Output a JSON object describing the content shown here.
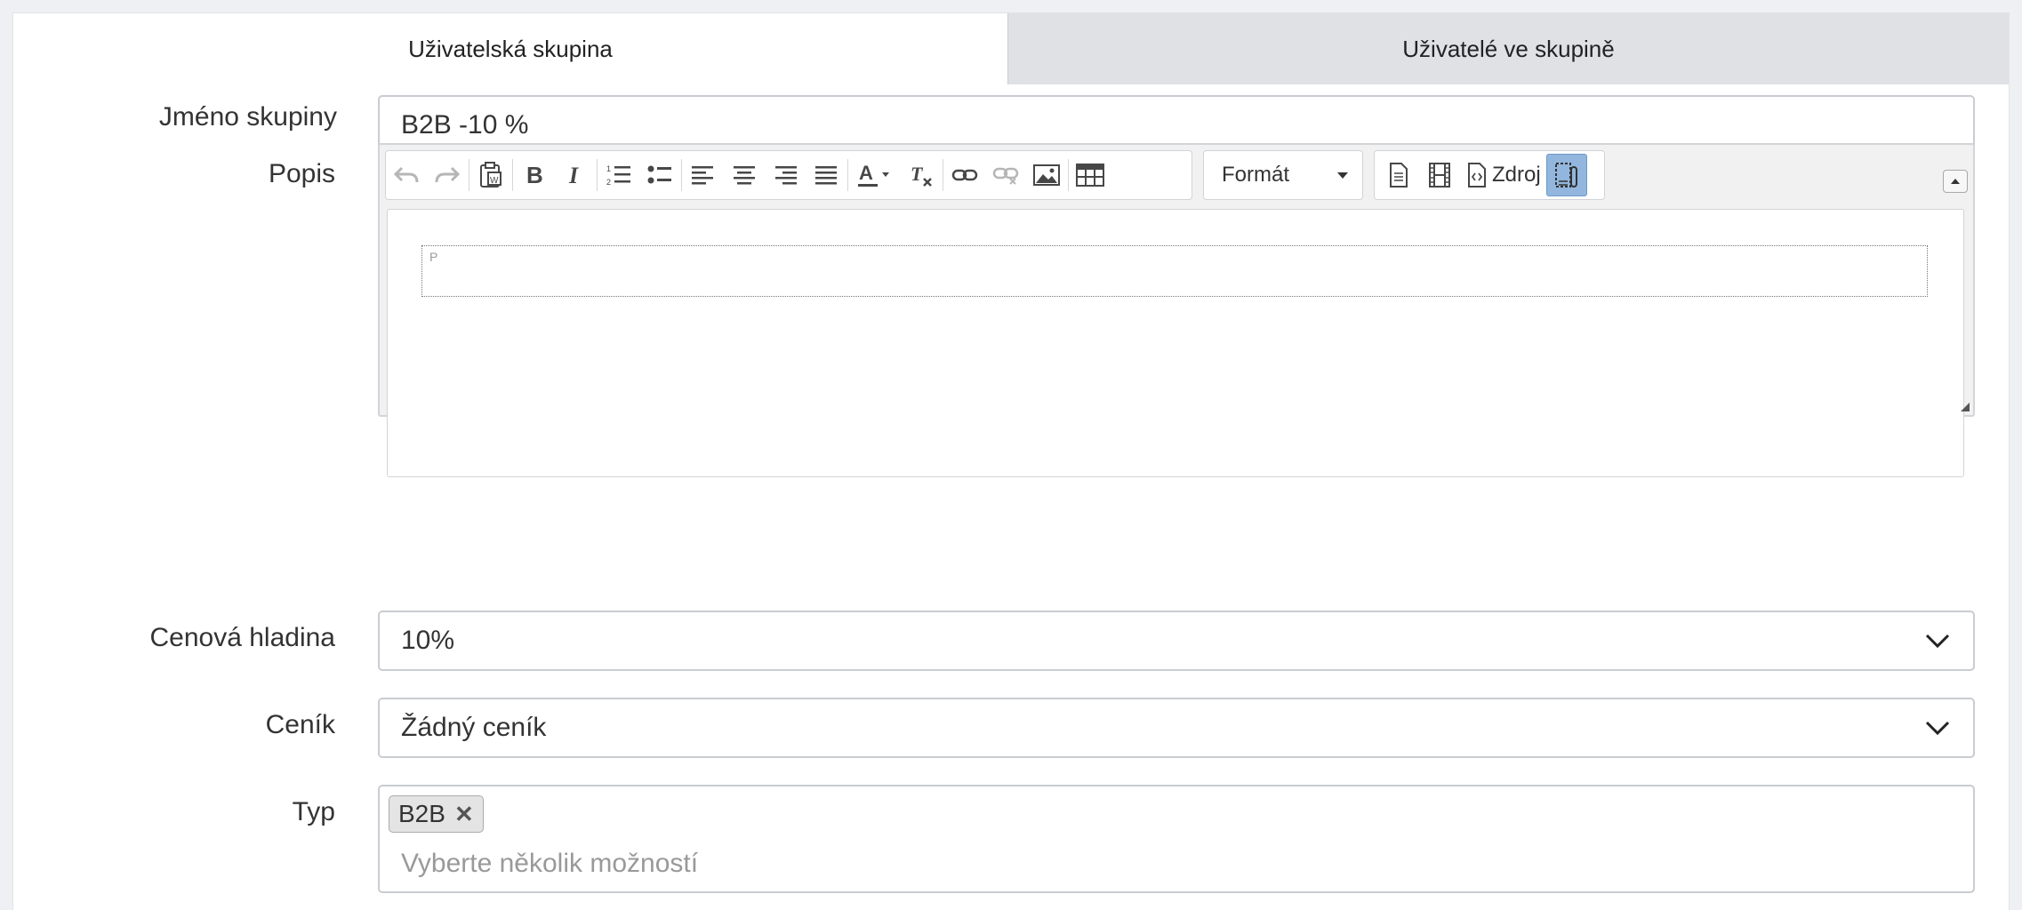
{
  "tabs": [
    {
      "label": "Uživatelská skupina",
      "active": true
    },
    {
      "label": "Uživatelé ve skupině",
      "active": false
    }
  ],
  "form": {
    "group_name": {
      "label": "Jméno skupiny",
      "value": "B2B -10 %"
    },
    "description": {
      "label": "Popis",
      "toolbar": {
        "format_label": "Formát",
        "source_label": "Zdroj",
        "buttons": [
          "undo-icon",
          "redo-icon",
          "paste-word-icon",
          "bold-icon",
          "italic-icon",
          "numbered-list-icon",
          "bulleted-list-icon",
          "align-left-icon",
          "align-center-icon",
          "align-right-icon",
          "justify-icon",
          "text-color-icon",
          "remove-format-icon",
          "link-icon",
          "unlink-icon",
          "image-icon",
          "table-icon",
          "templates-icon",
          "media-icon",
          "source-icon",
          "show-blocks-icon"
        ]
      },
      "content_tag": "P"
    },
    "price_level": {
      "label": "Cenová hladina",
      "value": "10%"
    },
    "price_list": {
      "label": "Ceník",
      "value": "Žádný ceník"
    },
    "type": {
      "label": "Typ",
      "selected": [
        "B2B"
      ],
      "placeholder": "Vyberte několik možností"
    }
  },
  "colors": {
    "tab_inactive": "#dfe1e5",
    "border": "#c9ccd1",
    "toggle_active": "#92b6dd"
  }
}
